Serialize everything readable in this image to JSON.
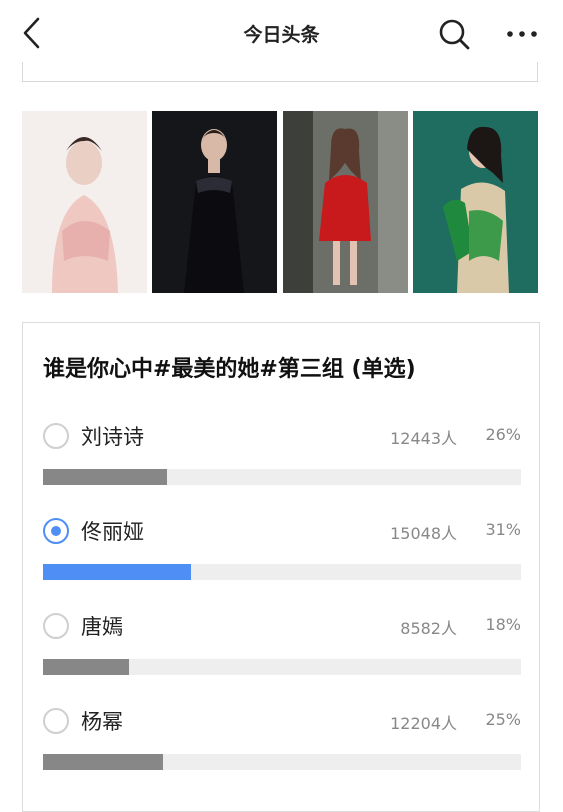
{
  "header": {
    "title": "今日头条",
    "back_icon": "chevron-left-icon",
    "search_icon": "search-icon",
    "more_icon": "more-horizontal-icon"
  },
  "photos": [
    {
      "alt": "photo-1"
    },
    {
      "alt": "photo-2"
    },
    {
      "alt": "photo-3"
    },
    {
      "alt": "photo-4"
    }
  ],
  "poll": {
    "title": "谁是你心中#最美的她#第三组 (单选)",
    "options": [
      {
        "name": "刘诗诗",
        "count": "12443人",
        "percent": "26%",
        "fraction": 0.26,
        "selected": false
      },
      {
        "name": "佟丽娅",
        "count": "15048人",
        "percent": "31%",
        "fraction": 0.31,
        "selected": true
      },
      {
        "name": "唐嫣",
        "count": "8582人",
        "percent": "18%",
        "fraction": 0.18,
        "selected": false
      },
      {
        "name": "杨幂",
        "count": "12204人",
        "percent": "25%",
        "fraction": 0.25,
        "selected": false
      }
    ],
    "colors": {
      "selected": "#4f8ef5",
      "unselected": "#878787",
      "track": "#eeeeef"
    }
  }
}
